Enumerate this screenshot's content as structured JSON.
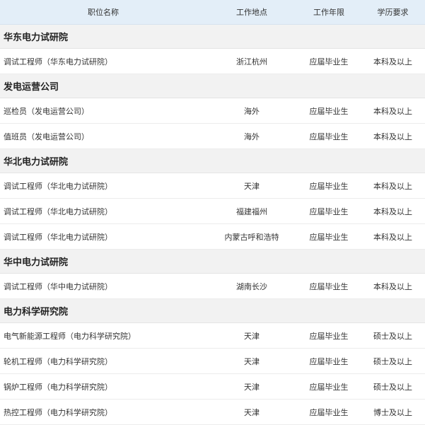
{
  "header": {
    "col_position": "职位名称",
    "col_location": "工作地点",
    "col_years": "工作年限",
    "col_education": "学历要求"
  },
  "groups": [
    {
      "name": "华东电力试研院",
      "rows": [
        {
          "title": "调试工程师（华东电力试研院）",
          "location": "浙江杭州",
          "years": "应届毕业生",
          "education": "本科及以上"
        }
      ]
    },
    {
      "name": "发电运营公司",
      "rows": [
        {
          "title": "巡检员（发电运营公司）",
          "location": "海外",
          "years": "应届毕业生",
          "education": "本科及以上"
        },
        {
          "title": "值班员（发电运营公司）",
          "location": "海外",
          "years": "应届毕业生",
          "education": "本科及以上"
        }
      ]
    },
    {
      "name": "华北电力试研院",
      "rows": [
        {
          "title": "调试工程师（华北电力试研院）",
          "location": "天津",
          "years": "应届毕业生",
          "education": "本科及以上"
        },
        {
          "title": "调试工程师（华北电力试研院）",
          "location": "福建福州",
          "years": "应届毕业生",
          "education": "本科及以上"
        },
        {
          "title": "调试工程师（华北电力试研院）",
          "location": "内蒙古呼和浩特",
          "years": "应届毕业生",
          "education": "本科及以上"
        }
      ]
    },
    {
      "name": "华中电力试研院",
      "rows": [
        {
          "title": "调试工程师（华中电力试研院）",
          "location": "湖南长沙",
          "years": "应届毕业生",
          "education": "本科及以上"
        }
      ]
    },
    {
      "name": "电力科学研究院",
      "rows": [
        {
          "title": "电气新能源工程师（电力科学研究院）",
          "location": "天津",
          "years": "应届毕业生",
          "education": "硕士及以上"
        },
        {
          "title": "轮机工程师（电力科学研究院）",
          "location": "天津",
          "years": "应届毕业生",
          "education": "硕士及以上"
        },
        {
          "title": "锅炉工程师（电力科学研究院）",
          "location": "天津",
          "years": "应届毕业生",
          "education": "硕士及以上"
        },
        {
          "title": "热控工程师（电力科学研究院）",
          "location": "天津",
          "years": "应届毕业生",
          "education": "博士及以上"
        }
      ]
    }
  ]
}
